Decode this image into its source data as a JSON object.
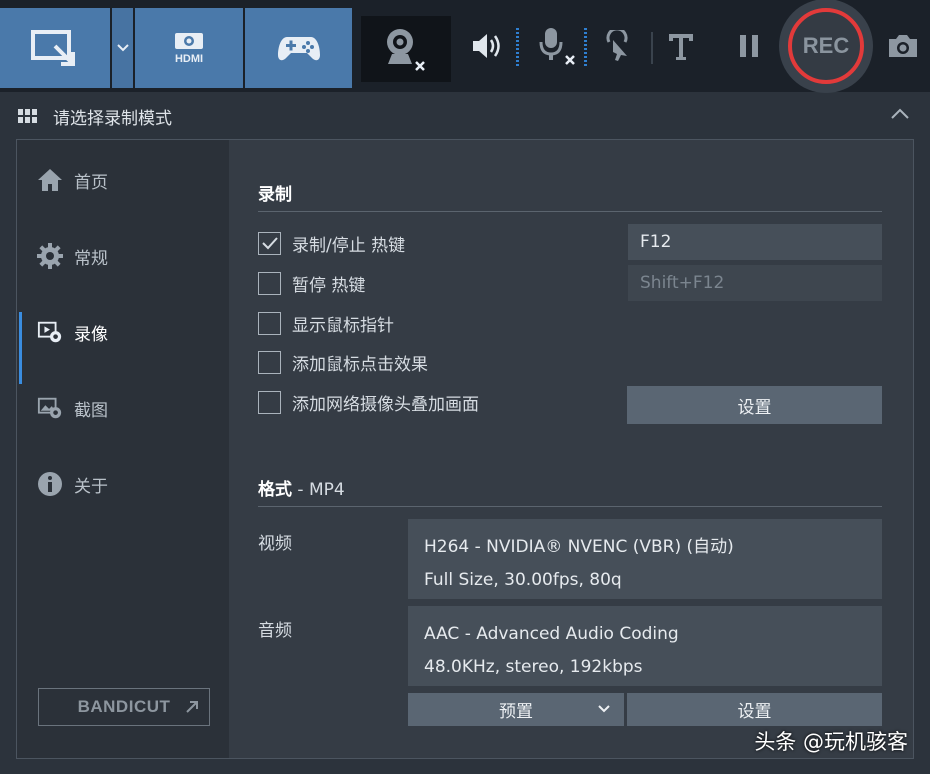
{
  "toolbar": {
    "modes": [
      {
        "name": "screen-record-mode",
        "icon": "screen-area-icon"
      },
      {
        "name": "hdmi-mode",
        "icon": "hdmi-icon",
        "label": "HDMI"
      },
      {
        "name": "game-mode",
        "icon": "gamepad-icon"
      }
    ],
    "rec_label": "REC",
    "accent": "#4a79aa",
    "rec_color": "#e23a3a"
  },
  "header": {
    "title": "请选择录制模式"
  },
  "sidebar": {
    "items": [
      {
        "label": "首页",
        "icon": "home-icon"
      },
      {
        "label": "常规",
        "icon": "gear-icon"
      },
      {
        "label": "录像",
        "icon": "video-settings-icon",
        "active": true
      },
      {
        "label": "截图",
        "icon": "image-settings-icon"
      },
      {
        "label": "关于",
        "icon": "info-icon"
      }
    ],
    "bandicut": {
      "part1": "BANDI",
      "part2": "CUT"
    }
  },
  "record": {
    "title": "录制",
    "options": [
      {
        "label": "录制/停止 热键",
        "checked": true
      },
      {
        "label": "暂停 热键",
        "checked": false
      },
      {
        "label": "显示鼠标指针",
        "checked": false
      },
      {
        "label": "添加鼠标点击效果",
        "checked": false
      },
      {
        "label": "添加网络摄像头叠加画面",
        "checked": false
      }
    ],
    "hotkey_record": "F12",
    "hotkey_pause": "Shift+F12",
    "webcam_settings_label": "设置"
  },
  "format": {
    "title": "格式",
    "container": " - MP4",
    "video_label": "视频",
    "video_line1": "H264 - NVIDIA® NVENC (VBR) (自动)",
    "video_line2": "Full Size, 30.00fps, 80q",
    "audio_label": "音频",
    "audio_line1": "AAC - Advanced Audio Coding",
    "audio_line2": "48.0KHz, stereo, 192kbps",
    "preset_label": "预置",
    "settings_label": "设置"
  },
  "watermark": "头条 @玩机骇客"
}
